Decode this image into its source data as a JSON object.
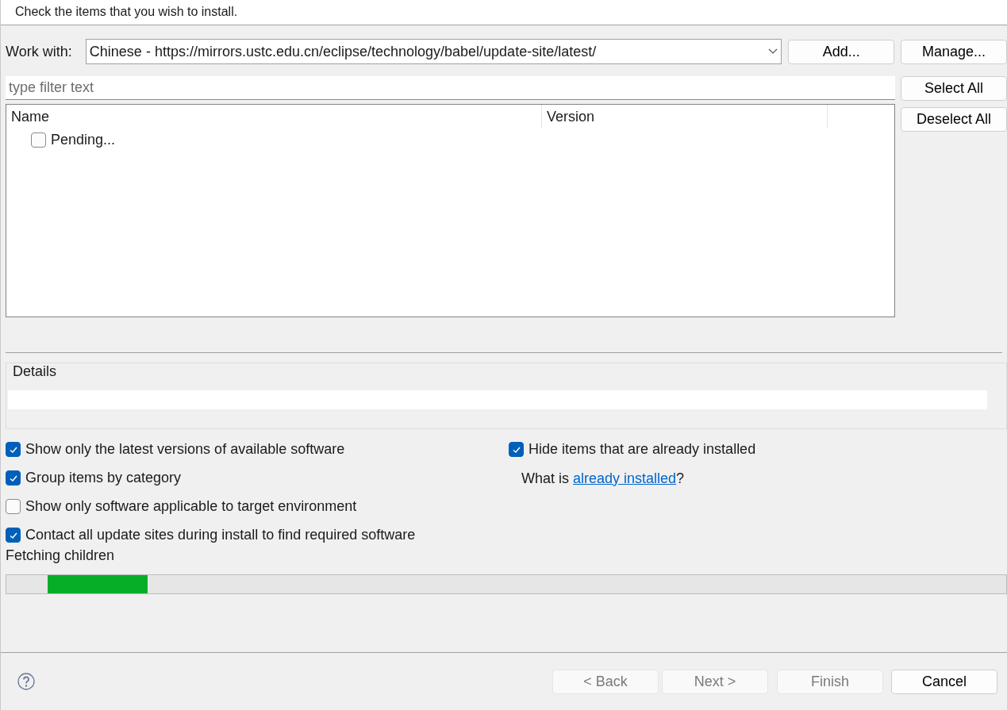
{
  "header": {
    "message": "Check the items that you wish to install."
  },
  "work_with": {
    "label": "Work with:",
    "value": "Chinese - https://mirrors.ustc.edu.cn/eclipse/technology/babel/update-site/latest/",
    "buttons": [
      "Add...",
      "Manage..."
    ]
  },
  "filter": {
    "placeholder": "type filter text"
  },
  "side_buttons": [
    "Select All",
    "Deselect All"
  ],
  "table": {
    "columns": [
      "Name",
      "Version"
    ],
    "rows": [
      {
        "name": "Pending...",
        "checked": false
      }
    ]
  },
  "details": {
    "title": "Details"
  },
  "options_left": [
    {
      "label": "Show only the latest versions of available software",
      "checked": true
    },
    {
      "label": "Group items by category",
      "checked": true
    },
    {
      "label": "Show only software applicable to target environment",
      "checked": false
    },
    {
      "label": "Contact all update sites during install to find required software",
      "checked": true
    }
  ],
  "options_right": {
    "hide_installed": {
      "label": "Hide items that are already installed",
      "checked": true
    },
    "what_is": {
      "before": "What is ",
      "link": "already installed",
      "after": "?"
    }
  },
  "status": {
    "text": "Fetching children",
    "level": 0.1
  },
  "footer": {
    "buttons": [
      {
        "label": "< Back",
        "disabled": true
      },
      {
        "label": "Next >",
        "disabled": true
      },
      {
        "label": "Finish",
        "disabled": true
      },
      {
        "label": "Cancel",
        "disabled": false
      }
    ]
  }
}
